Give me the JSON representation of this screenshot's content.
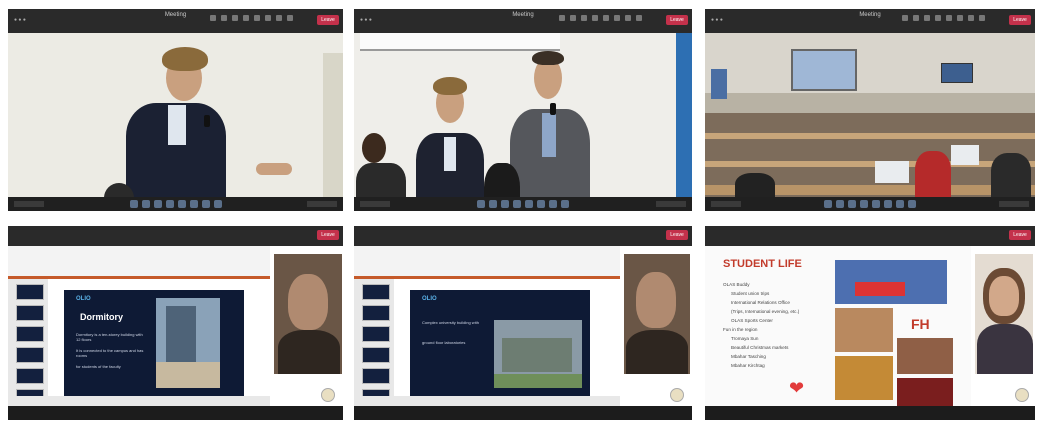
{
  "panels": [
    {
      "window_title": "Meeting",
      "leave_label": "Leave"
    },
    {
      "window_title": "Meeting",
      "leave_label": "Leave"
    },
    {
      "window_title": "Meeting",
      "leave_label": "Leave"
    },
    {
      "window_title": "",
      "leave_label": "Leave",
      "slide_title": "Dormitory",
      "slide_brand": "OLIO",
      "slide_text": [
        "Dormitory is a ten-storey building with 12 floors",
        "It is connected to the campus and has rooms",
        "for students of the faculty"
      ]
    },
    {
      "window_title": "",
      "leave_label": "Leave",
      "slide_brand": "OLIO",
      "slide_text": [
        "Complex university building with",
        "ground floor laboratories"
      ]
    },
    {
      "window_title": "",
      "leave_label": "Leave",
      "slide_title": "STUDENT LIFE",
      "bullets": [
        "OLAS Buddy",
        "Student union trips",
        "International Relations Office",
        "(Trips, International evening, etc.)",
        "OLAS Sports Center",
        "Fun in the region",
        "Tromaya Sun",
        "Beautiful Christmas markets",
        "Mbahar Tasching",
        "Mbahar Kirchtag"
      ],
      "logo_text": "FH"
    }
  ],
  "colors": {
    "leave": "#c4314b",
    "slide_bg": "#0e1a35",
    "accent_red": "#c23b2b"
  },
  "icons": {
    "reaction": "raise-hand-icon",
    "heart": "heart-icon"
  }
}
